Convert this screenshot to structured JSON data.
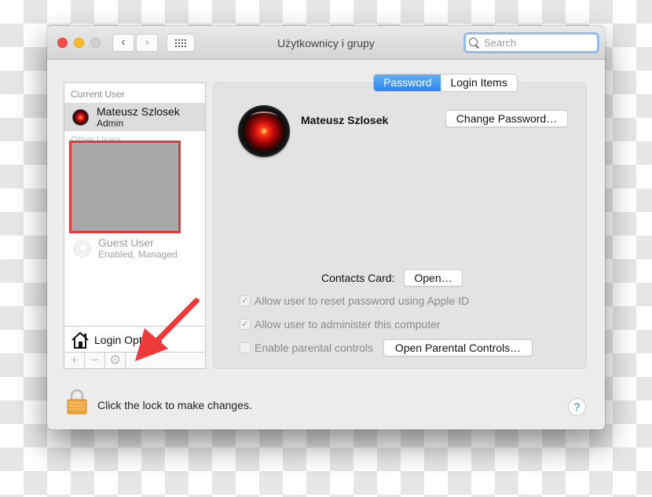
{
  "window": {
    "title": "Użytkownicy i grupy",
    "search": {
      "placeholder": "Search",
      "value": ""
    },
    "nav": {
      "back_glyph": "‹",
      "forward_glyph": "›"
    }
  },
  "sidebar": {
    "current_user_label": "Current User",
    "current_user": {
      "name": "Mateusz Szlosek",
      "role": "Admin",
      "avatar": "hal-9000-eye"
    },
    "other_users_label": "Other Users",
    "guest_user": {
      "name": "Guest User",
      "status": "Enabled, Managed"
    },
    "login_options_label": "Login Options",
    "tools": {
      "add": "+",
      "remove": "−",
      "gear": "⚙"
    }
  },
  "panel": {
    "tabs": [
      {
        "label": "Password",
        "active": true
      },
      {
        "label": "Login Items",
        "active": false
      }
    ],
    "username": "Mateusz Szlosek",
    "change_password_label": "Change Password…",
    "contacts_card_label": "Contacts Card:",
    "open_label": "Open…",
    "checkboxes": [
      {
        "label": "Allow user to reset password using Apple ID",
        "checked": true,
        "enabled": false
      },
      {
        "label": "Allow user to administer this computer",
        "checked": true,
        "enabled": false
      },
      {
        "label": "Enable parental controls",
        "checked": false,
        "enabled": false
      }
    ],
    "open_parental_label": "Open Parental Controls…"
  },
  "footer": {
    "lock_text": "Click the lock to make changes.",
    "help_label": "?"
  },
  "colors": {
    "tab_active": "#2c86f2",
    "annotation_arrow": "#f03a3a",
    "redaction_border": "#e4383a",
    "lock": "#f0a63e"
  }
}
